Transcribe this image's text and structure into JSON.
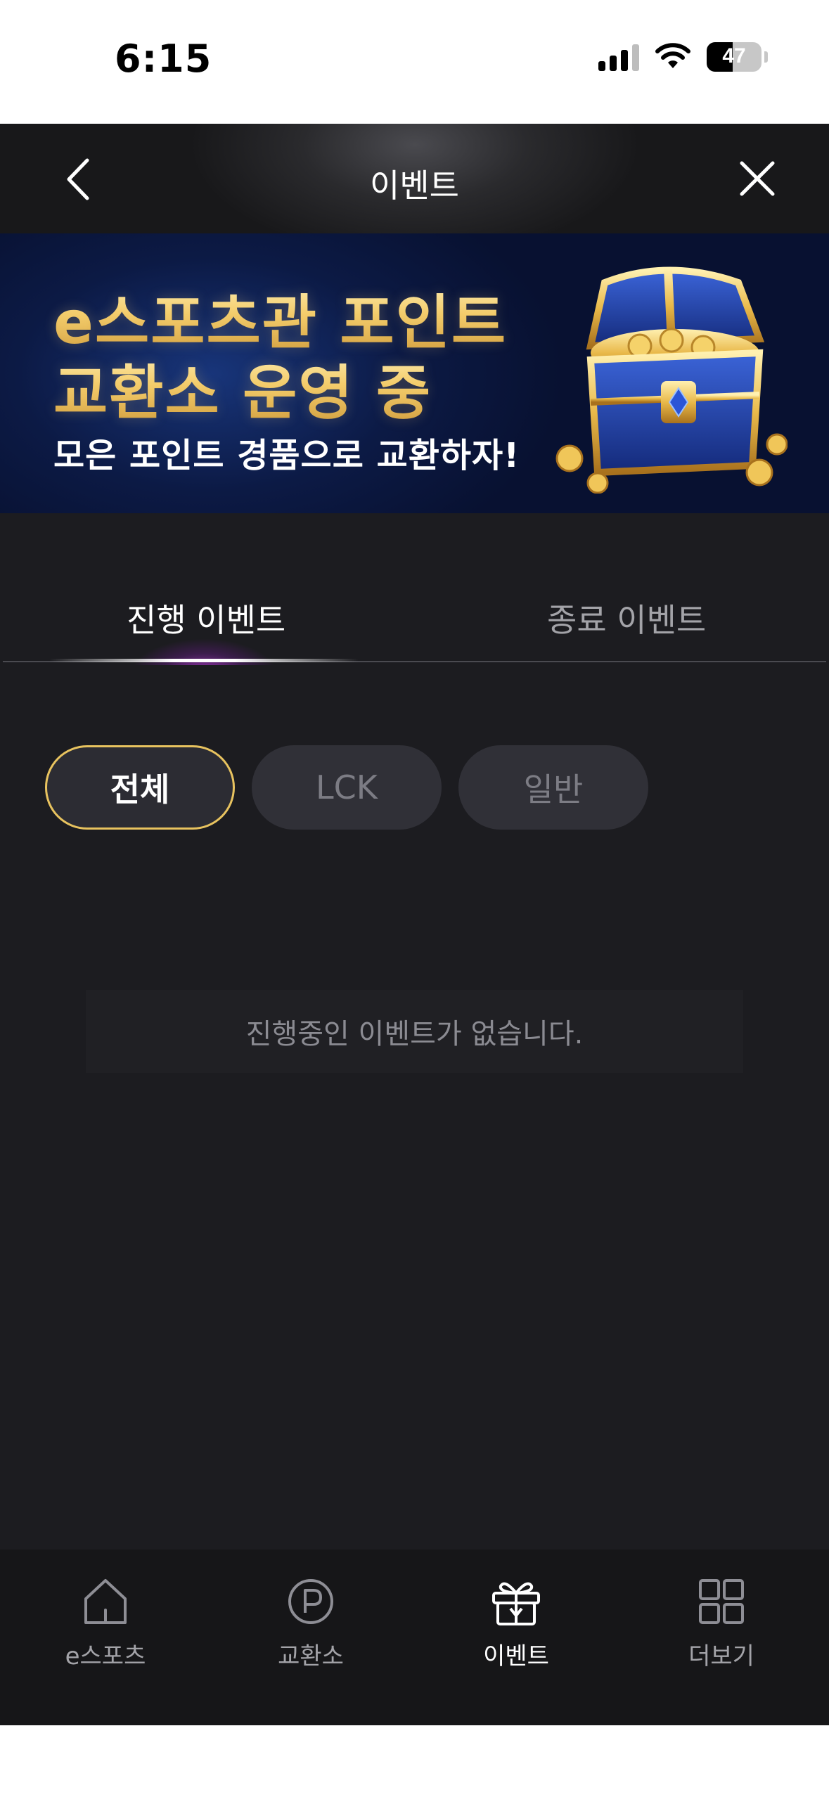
{
  "status_bar": {
    "time": "6:15",
    "battery": "47",
    "battery_level": 0.47
  },
  "header": {
    "title": "이벤트",
    "back_icon": "chevron-left-icon",
    "close_icon": "close-icon"
  },
  "banner": {
    "line1": "e스포츠관 포인트",
    "line2": "교환소 운영 중",
    "subtitle": "모은 포인트 경품으로 교환하자!",
    "image": "treasure-chest-image"
  },
  "tabs": [
    {
      "label": "진행 이벤트",
      "active": true
    },
    {
      "label": "종료 이벤트",
      "active": false
    }
  ],
  "filters": [
    {
      "label": "전체",
      "active": true
    },
    {
      "label": "LCK",
      "active": false
    },
    {
      "label": "일반",
      "active": false
    }
  ],
  "empty_message": "진행중인 이벤트가 없습니다.",
  "bottom_nav": [
    {
      "label": "e스포츠",
      "icon": "home-icon",
      "active": false
    },
    {
      "label": "교환소",
      "icon": "point-icon",
      "active": false
    },
    {
      "label": "이벤트",
      "icon": "gift-icon",
      "active": true
    },
    {
      "label": "더보기",
      "icon": "grid-icon",
      "active": false
    }
  ],
  "colors": {
    "background": "#1c1c20",
    "accent": "#e8c35f",
    "banner_bg": "#0c1a45",
    "tab_glow": "#be3cdc"
  }
}
